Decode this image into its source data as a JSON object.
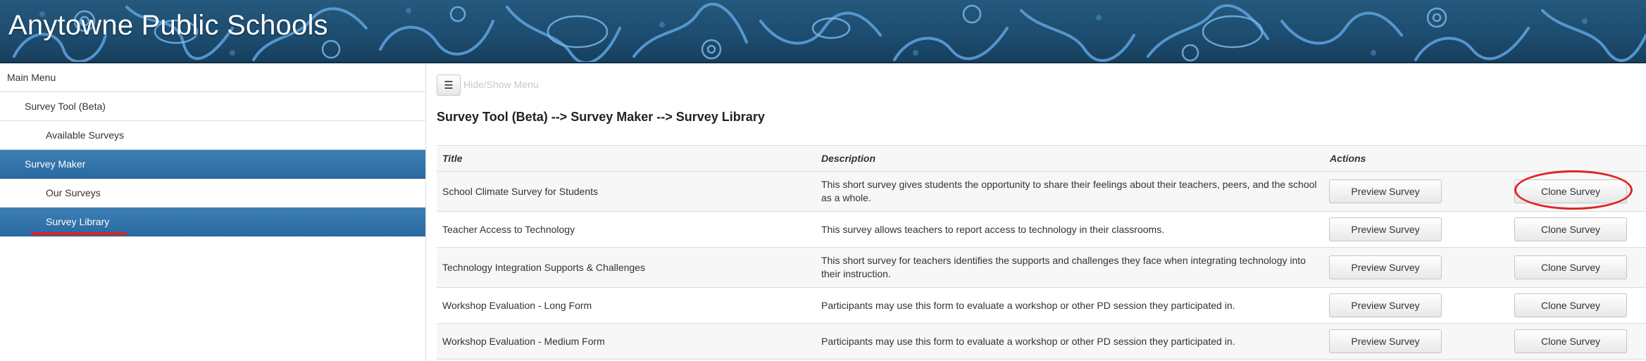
{
  "banner": {
    "title": "Anytowne Public Schools"
  },
  "sidebar": {
    "items": [
      {
        "label": "Main Menu"
      },
      {
        "label": "Survey Tool (Beta)"
      },
      {
        "label": "Available Surveys"
      },
      {
        "label": "Survey Maker"
      },
      {
        "label": "Our Surveys"
      },
      {
        "label": "Survey Library"
      }
    ]
  },
  "main": {
    "toggle_icon": "☰",
    "toggle_label": "Hide/Show Menu",
    "breadcrumb": "Survey Tool (Beta) --> Survey Maker --> Survey Library",
    "table": {
      "headers": [
        "Title",
        "Description",
        "Actions"
      ],
      "preview_label": "Preview Survey",
      "clone_label": "Clone Survey",
      "rows": [
        {
          "title": "School Climate Survey for Students",
          "description": "This short survey gives students the opportunity to share their feelings about their teachers, peers, and the school as a whole."
        },
        {
          "title": "Teacher Access to Technology",
          "description": "This survey allows teachers to report access to technology in their classrooms."
        },
        {
          "title": "Technology Integration Supports & Challenges",
          "description": "This short survey for teachers identifies the supports and challenges they face when integrating technology into their instruction."
        },
        {
          "title": "Workshop Evaluation - Long Form",
          "description": "Participants may use this form to evaluate a workshop or other PD session they participated in."
        },
        {
          "title": "Workshop Evaluation - Medium Form",
          "description": "Participants may use this form to evaluate a workshop or other PD session they participated in."
        }
      ]
    }
  },
  "colors": {
    "active_nav": "#2f70a8",
    "highlight": "#e02424",
    "banner": "#1d4d70"
  }
}
